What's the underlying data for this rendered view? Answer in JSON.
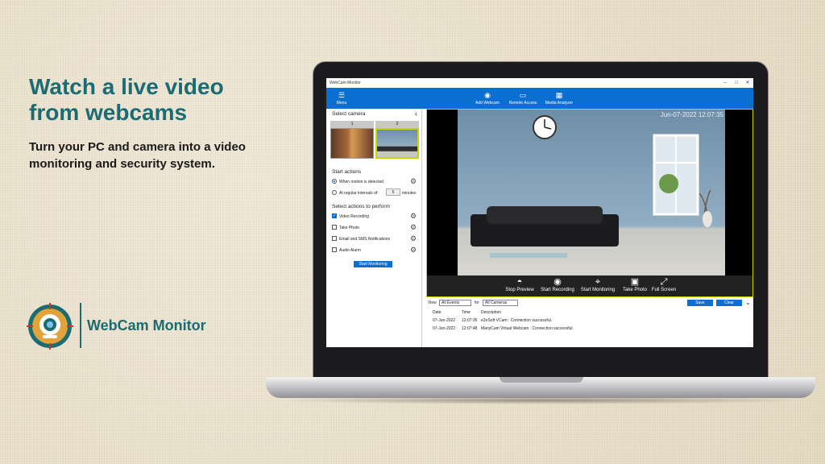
{
  "promo": {
    "headline_line1": "Watch a live video",
    "headline_line2": "from webcams",
    "subtitle_line1": "Turn your PC and camera into a video",
    "subtitle_line2": "monitoring and security system.",
    "brand_name": "WebCam Monitor",
    "accent_color": "#1b6b73"
  },
  "app": {
    "window_title": "WebCam Monitor",
    "window_controls": [
      "–",
      "□",
      "✕"
    ],
    "toolbar": {
      "menu_label": "Menu",
      "add_webcam_label": "Add Webcam",
      "remote_access_label": "Remote Access",
      "media_analyzer_label": "Media Analyzer",
      "color": "#0b6fd1"
    },
    "sidebar": {
      "select_camera_title": "Select camera",
      "collapse_icon": "chevron-left-icon",
      "cameras": [
        "1",
        "2"
      ],
      "start_actions_title": "Start actions",
      "motion_option": "When motion is detected",
      "interval_option": "At regular intervals of:",
      "interval_value": "5",
      "interval_unit": "minutes",
      "actions_title": "Select actions to perform",
      "actions": [
        {
          "label": "Video Recording",
          "checked": true
        },
        {
          "label": "Take Photo",
          "checked": false
        },
        {
          "label": "Email and SMS Notifications",
          "checked": false
        },
        {
          "label": "Audio Alarm",
          "checked": false
        }
      ],
      "start_monitoring_button": "Start Monitoring"
    },
    "video": {
      "timestamp": "Jun-07-2022 12:07:35",
      "controls": [
        "Stop Preview",
        "Start Recording",
        "Start Monitoring",
        "Take Photo",
        "Full Screen"
      ]
    },
    "filter": {
      "view_label": "View",
      "view_value": "All Events",
      "for_label": "for",
      "for_value": "All Cameras",
      "save_button": "Save",
      "clear_button": "Clear"
    },
    "log": {
      "headers": [
        "Date",
        "Time",
        "Description"
      ],
      "rows": [
        [
          "07-Jun-2022",
          "12:07:35",
          "e2eSoft VCam : Connection successful."
        ],
        [
          "07-Jun-2022",
          "12:07:48",
          "ManyCam Virtual Webcam : Connection successful."
        ]
      ]
    }
  }
}
